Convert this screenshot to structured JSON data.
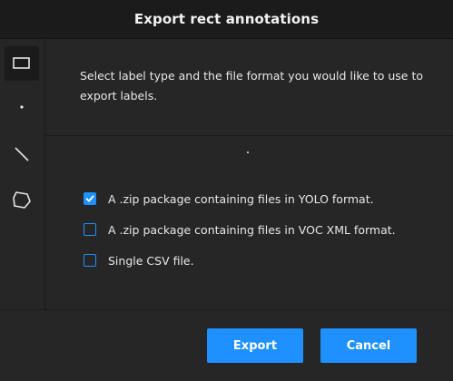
{
  "dialog": {
    "title": "Export rect annotations",
    "description": "Select label type and the file format you would like to use to export labels."
  },
  "toolbar": {
    "tools": [
      {
        "name": "rect-icon",
        "active": true
      },
      {
        "name": "point-icon",
        "active": false
      },
      {
        "name": "line-icon",
        "active": false
      },
      {
        "name": "polygon-icon",
        "active": false
      }
    ]
  },
  "options": [
    {
      "label": "A .zip package containing files in YOLO format.",
      "checked": true
    },
    {
      "label": "A .zip package containing files in VOC XML format.",
      "checked": false
    },
    {
      "label": "Single CSV file.",
      "checked": false
    }
  ],
  "footer": {
    "export_label": "Export",
    "cancel_label": "Cancel"
  },
  "colors": {
    "accent": "#1e90ff",
    "header_bg": "#1b1b1b",
    "panel_bg": "#262626"
  }
}
